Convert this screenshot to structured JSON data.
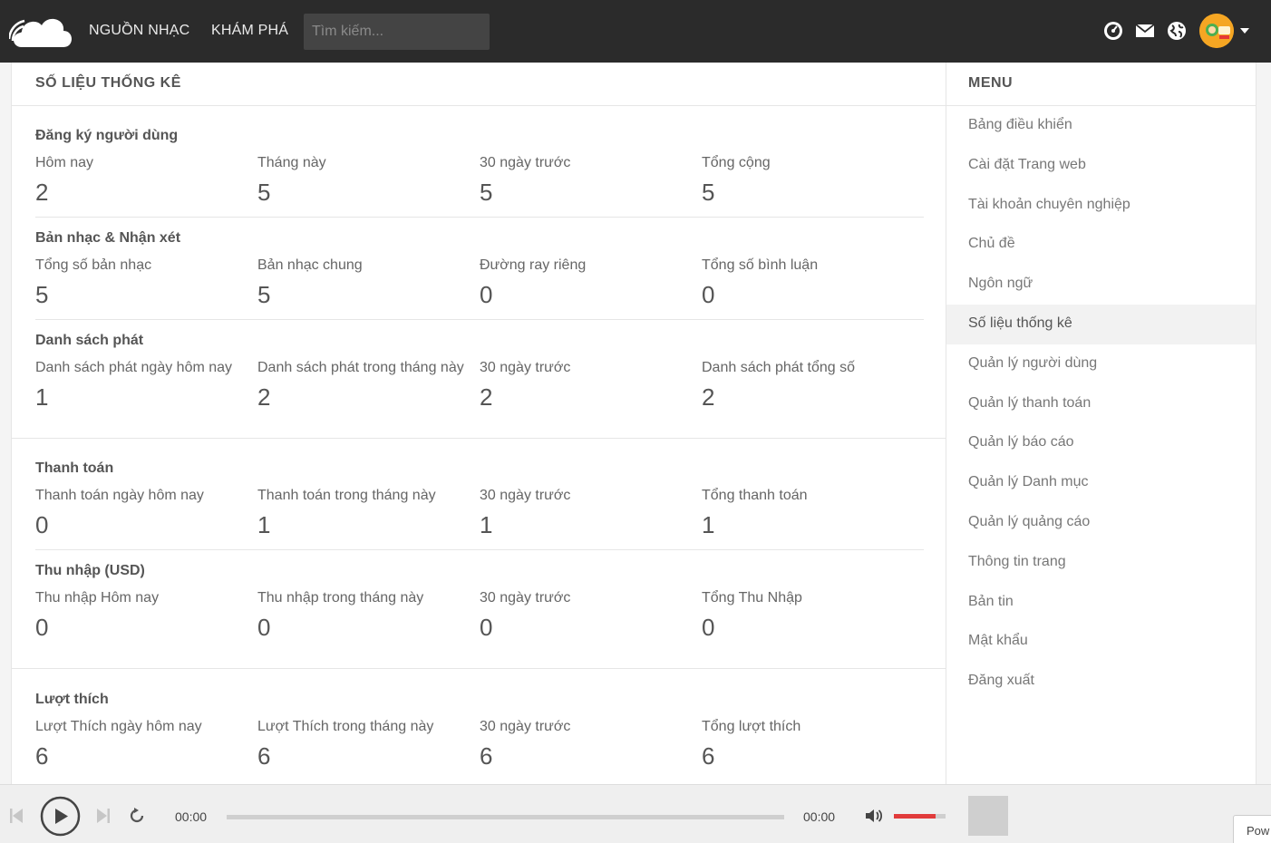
{
  "nav": {
    "sources_label": "NGUỒN NHẠC",
    "explore_label": "KHÁM PHÁ",
    "search_placeholder": "Tìm kiếm..."
  },
  "main": {
    "title": "SỐ LIỆU THỐNG KÊ",
    "groups": [
      {
        "title": "Đăng ký người dùng",
        "stats": [
          {
            "label": "Hôm nay",
            "value": "2"
          },
          {
            "label": "Tháng này",
            "value": "5"
          },
          {
            "label": "30 ngày trước",
            "value": "5"
          },
          {
            "label": "Tổng cộng",
            "value": "5"
          }
        ]
      },
      {
        "title": "Bản nhạc & Nhận xét",
        "stats": [
          {
            "label": "Tổng số bản nhạc",
            "value": "5"
          },
          {
            "label": "Bản nhạc chung",
            "value": "5"
          },
          {
            "label": "Đường ray riêng",
            "value": "0"
          },
          {
            "label": "Tổng số bình luận",
            "value": "0"
          }
        ]
      },
      {
        "title": "Danh sách phát",
        "stats": [
          {
            "label": "Danh sách phát ngày hôm nay",
            "value": "1"
          },
          {
            "label": "Danh sách phát trong tháng này",
            "value": "2"
          },
          {
            "label": "30 ngày trước",
            "value": "2"
          },
          {
            "label": "Danh sách phát tổng số",
            "value": "2"
          }
        ]
      },
      {
        "title": "Thanh toán",
        "stats": [
          {
            "label": "Thanh toán ngày hôm nay",
            "value": "0"
          },
          {
            "label": "Thanh toán trong tháng này",
            "value": "1"
          },
          {
            "label": "30 ngày trước",
            "value": "1"
          },
          {
            "label": "Tổng thanh toán",
            "value": "1"
          }
        ]
      },
      {
        "title": "Thu nhập (USD)",
        "stats": [
          {
            "label": "Thu nhập Hôm nay",
            "value": "0"
          },
          {
            "label": "Thu nhập trong tháng này",
            "value": "0"
          },
          {
            "label": "30 ngày trước",
            "value": "0"
          },
          {
            "label": "Tổng Thu Nhập",
            "value": "0"
          }
        ]
      },
      {
        "title": "Lượt thích",
        "stats": [
          {
            "label": "Lượt Thích ngày hôm nay",
            "value": "6"
          },
          {
            "label": "Lượt Thích trong tháng này",
            "value": "6"
          },
          {
            "label": "30 ngày trước",
            "value": "6"
          },
          {
            "label": "Tổng lượt thích",
            "value": "6"
          }
        ]
      }
    ]
  },
  "sidebar": {
    "title": "MENU",
    "items": [
      {
        "label": "Bảng điều khiển"
      },
      {
        "label": "Cài đặt Trang web"
      },
      {
        "label": "Tài khoản chuyên nghiệp"
      },
      {
        "label": "Chủ đề"
      },
      {
        "label": "Ngôn ngữ"
      },
      {
        "label": "Số liệu thống kê",
        "active": true
      },
      {
        "label": "Quản lý người dùng"
      },
      {
        "label": "Quản lý thanh toán"
      },
      {
        "label": "Quản lý báo cáo"
      },
      {
        "label": "Quản lý Danh mục"
      },
      {
        "label": "Quản lý quảng cáo"
      },
      {
        "label": "Thông tin trang"
      },
      {
        "label": "Bản tin"
      },
      {
        "label": "Mật khẩu"
      },
      {
        "label": "Đăng xuất"
      }
    ]
  },
  "player": {
    "current_time": "00:00",
    "duration": "00:00",
    "volume_level": 0.8,
    "powered_label": "Pow"
  },
  "colors": {
    "topbar": "#2b2b2b",
    "volume_accent": "#e13b3b",
    "avatar_bg": "#f5a623"
  }
}
